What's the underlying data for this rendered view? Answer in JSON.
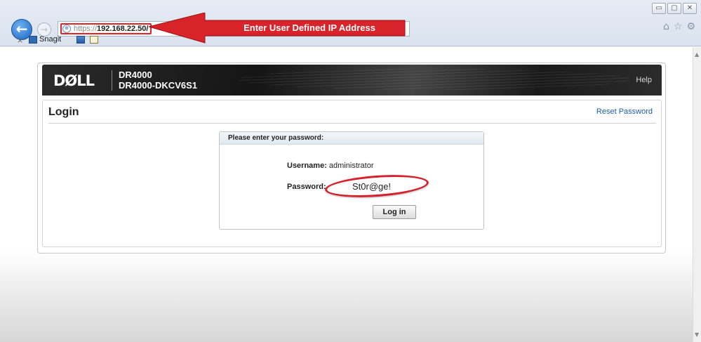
{
  "browser": {
    "url_protocol": "https://",
    "url_host": "192.168.22.50/",
    "back_glyph": "←",
    "forward_glyph": "→",
    "site_icon_glyph": "⊕",
    "annotation": "Enter User Defined IP Address",
    "annotation_color": "#d8232a",
    "window_controls": [
      "▭",
      "▢",
      "✕"
    ],
    "right_icons": [
      "⌂",
      "☆",
      "⚙"
    ],
    "toolbar": {
      "close_glyph": "×",
      "snagit_label": "Snagit"
    }
  },
  "app": {
    "brand": "DØLL",
    "product_name": "DR4000",
    "product_host": "DR4000-DKCV6S1",
    "help_label": "Help",
    "page_title": "Login",
    "reset_password_label": "Reset Password",
    "link_color": "#1c5da8",
    "login_box": {
      "header": "Please enter your password:",
      "username_label": "Username:",
      "username_value": "administrator",
      "password_label": "Password:",
      "password_value": "St0r@ge!",
      "login_button_label": "Log in"
    }
  },
  "scrollbar": {
    "up_glyph": "▲",
    "down_glyph": "▼"
  }
}
